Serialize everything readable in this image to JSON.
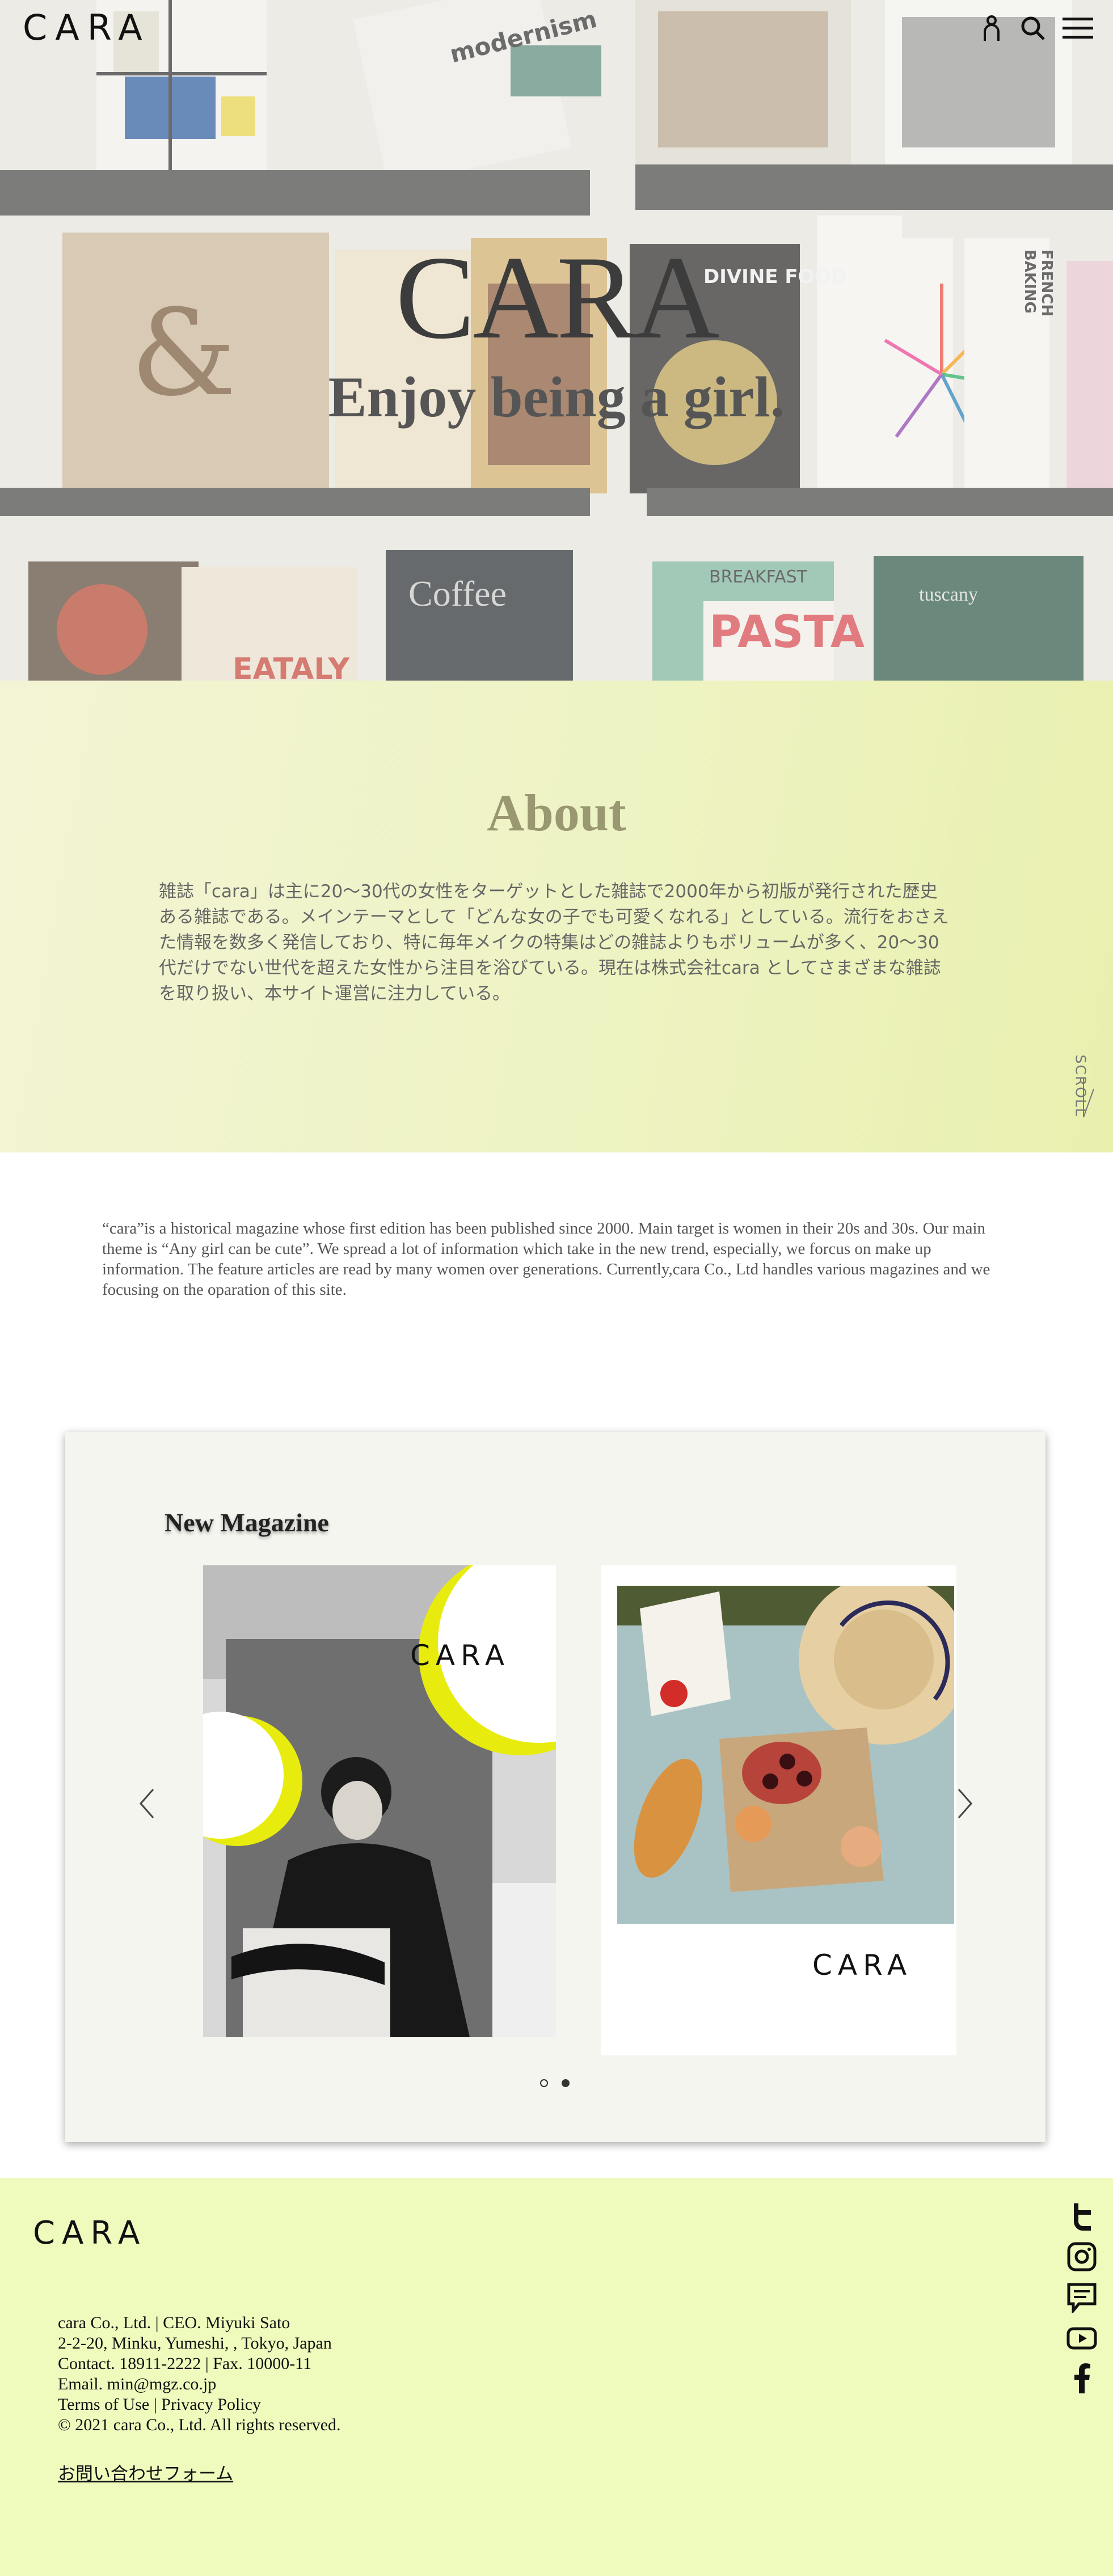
{
  "header": {
    "logo": "CARA",
    "icons": [
      "account-icon",
      "search-icon",
      "menu-icon"
    ]
  },
  "hero": {
    "title": "CARA",
    "subtitle": "Enjoy being a girl.",
    "background_image": "bookshelf-photo",
    "books": {
      "modernism": "modernism",
      "divine_food": "DIVINE FOOD",
      "french_baking": "FRENCH BAKING",
      "coffee": "Coffee",
      "eataly": "EATALY",
      "pasta": "PASTA",
      "breakfast": "BREAKFAST",
      "tuscany": "tuscany",
      "ampersand": "&"
    }
  },
  "about": {
    "title": "About",
    "text_ja": "雑誌「cara」は主に20〜30代の女性をターゲットとした雑誌で2000年から初版が発行された歴史ある雑誌である。メインテーマとして「どんな女の子でも可愛くなれる」としている。流行をおさえた情報を数多く発信しており、特に毎年メイクの特集はどの雑誌よりもボリュームが多く、20〜30代だけでない世代を超えた女性から注目を浴びている。現在は株式会社cara としてさまざまな雑誌を取り扱い、本サイト運営に注力している。",
    "scroll_label": "SCROLL",
    "text_en": "“cara”is a historical magazine whose first edition has been published since 2000. Main target is women in their 20s and 30s. Our main theme is “Any girl can be cute”. We spread a lot of information which take in the new trend, especially, we forcus on make up information. The feature articles are read by many women over generations. Currently,cara Co., Ltd handles various magazines and we focusing on the oparation of this site."
  },
  "magazine": {
    "title": "New Magazine",
    "covers": [
      {
        "brand": "CARA",
        "image": "woman-portrait-with-yellow-moons"
      },
      {
        "brand": "CARA",
        "image": "picnic-flatlay"
      }
    ],
    "prev_icon": "chevron-left-icon",
    "next_icon": "chevron-right-icon",
    "slides_total": 2,
    "active_slide": 1
  },
  "footer": {
    "logo": "CARA",
    "info": [
      "cara Co., Ltd. | CEO. Miyuki Sato",
      "2-2-20, Minku, Yumeshi, , Tokyo, Japan",
      "Contact. 18911-2222 | Fax. 10000-11",
      "Email. min@mgz.co.jp",
      "Terms of Use | Privacy Policy",
      "© 2021 cara Co., Ltd. All rights reserved."
    ],
    "contact_link": "お問い合わせフォーム",
    "social": [
      "twitter-icon",
      "instagram-icon",
      "chat-icon",
      "youtube-icon",
      "facebook-icon"
    ]
  },
  "colors": {
    "about_bg": "#eef3c3",
    "footer_bg": "#eefbbd",
    "accent_yellow": "#e8ec0e"
  }
}
